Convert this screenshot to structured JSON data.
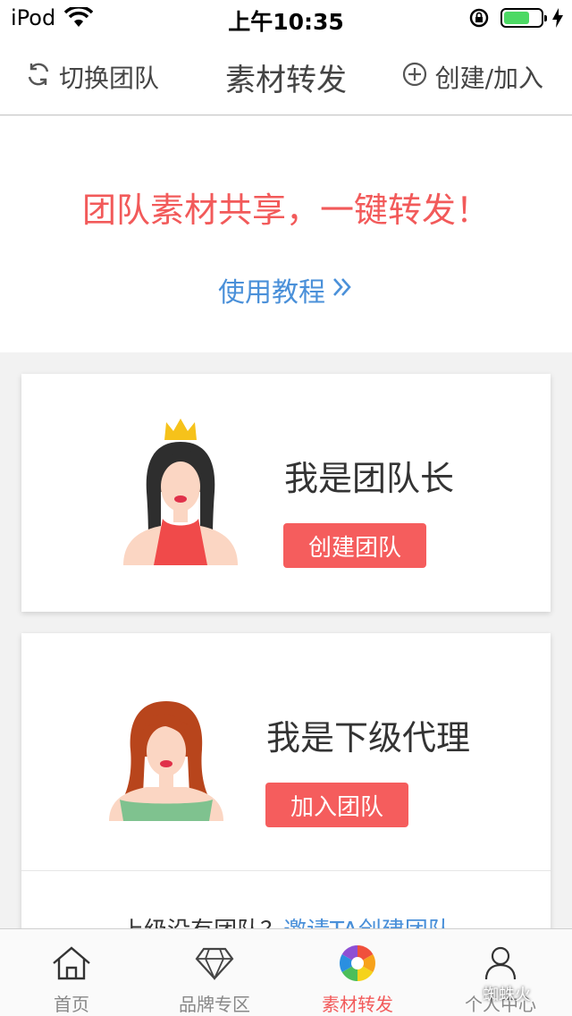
{
  "status_bar": {
    "carrier": "iPod",
    "time": "上午10:35"
  },
  "nav": {
    "left_label": "切换团队",
    "title": "素材转发",
    "right_label": "创建/加入"
  },
  "banner": {
    "slogan": "团队素材共享，一键转发！",
    "tutorial_link": "使用教程"
  },
  "leader_card": {
    "title": "我是团队长",
    "button": "创建团队"
  },
  "agent_card": {
    "title": "我是下级代理",
    "button": "加入团队",
    "invite_text": "上级没有团队？",
    "invite_link": "邀请TA创建团队"
  },
  "tabbar": {
    "items": [
      {
        "label": "首页",
        "icon": "home-icon"
      },
      {
        "label": "品牌专区",
        "icon": "diamond-icon"
      },
      {
        "label": "素材转发",
        "icon": "aperture-icon",
        "active": true
      },
      {
        "label": "个人中心",
        "icon": "person-icon"
      }
    ]
  },
  "watermark": "蜘蛛火",
  "colors": {
    "accent_red": "#f25a5a",
    "link_blue": "#4a90d9",
    "button_red": "#f55d5d",
    "battery_green": "#4cd964"
  }
}
